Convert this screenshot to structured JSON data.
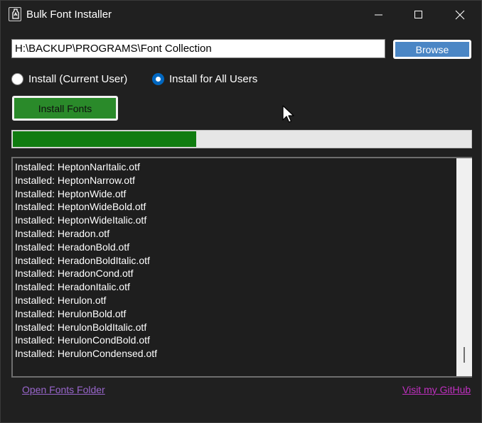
{
  "window": {
    "title": "Bulk Font Installer",
    "icons": {
      "app": "font-installer-icon",
      "minimize": "minimize-icon",
      "maximize": "maximize-icon",
      "close": "close-icon"
    }
  },
  "path": {
    "value": "H:\\BACKUP\\PROGRAMS\\Font Collection"
  },
  "browse": {
    "label": "Browse",
    "color": "#4a86c5"
  },
  "radios": {
    "current_user": {
      "label": "Install (Current User)",
      "checked": false
    },
    "all_users": {
      "label": "Install for All Users",
      "checked": true
    }
  },
  "install": {
    "label": "Install Fonts",
    "color": "#2a8a2a"
  },
  "progress": {
    "value": 0.4,
    "color": "#107c10"
  },
  "log": {
    "items": [
      "Installed: HeptonNarItalic.otf",
      "Installed: HeptonNarrow.otf",
      "Installed: HeptonWide.otf",
      "Installed: HeptonWideBold.otf",
      "Installed: HeptonWideItalic.otf",
      "Installed: Heradon.otf",
      "Installed: HeradonBold.otf",
      "Installed: HeradonBoldItalic.otf",
      "Installed: HeradonCond.otf",
      "Installed: HeradonItalic.otf",
      "Installed: Herulon.otf",
      "Installed: HerulonBold.otf",
      "Installed: HerulonBoldItalic.otf",
      "Installed: HerulonCondBold.otf",
      "Installed: HerulonCondensed.otf"
    ]
  },
  "links": {
    "open_folder": "Open Fonts Folder",
    "github": "Visit my GitHub"
  }
}
